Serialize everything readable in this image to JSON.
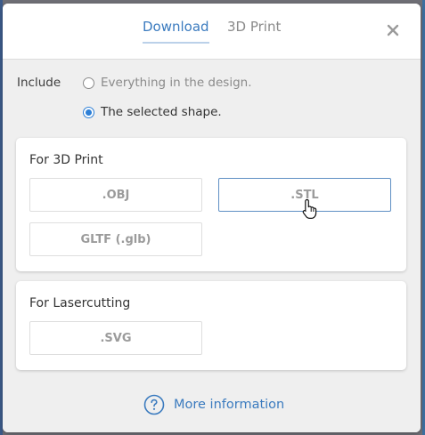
{
  "tabs": {
    "download": "Download",
    "print3d": "3D Print"
  },
  "include": {
    "label": "Include",
    "options": [
      {
        "label": "Everything in the design.",
        "selected": false
      },
      {
        "label": "The selected shape.",
        "selected": true
      }
    ]
  },
  "cards": {
    "print3d": {
      "title": "For 3D Print",
      "buttons": [
        ".OBJ",
        ".STL",
        "GLTF (.glb)"
      ]
    },
    "laser": {
      "title": "For Lasercutting",
      "buttons": [
        ".SVG"
      ]
    }
  },
  "more_info": {
    "label": "More information"
  },
  "colors": {
    "accent": "#3b7bbf",
    "radio_selected": "#2d7fd6"
  },
  "icons": {
    "close": "close-icon",
    "help": "question-circle-icon",
    "cursor": "hand-pointer-icon"
  }
}
